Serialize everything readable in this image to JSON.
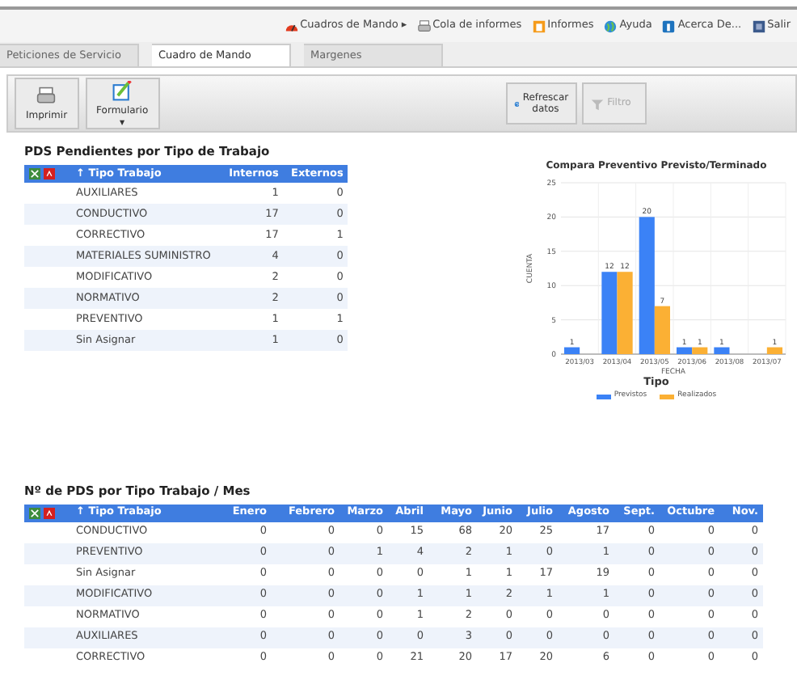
{
  "top_menu": [
    {
      "label": "Cuadros de Mando ▸",
      "kind": "dashboard"
    },
    {
      "label": "Cola de informes",
      "kind": "printer"
    },
    {
      "label": "Informes",
      "kind": "report"
    },
    {
      "label": "Ayuda",
      "kind": "help"
    },
    {
      "label": "Acerca De...",
      "kind": "info"
    },
    {
      "label": "Salir",
      "kind": "exit"
    }
  ],
  "tabs": [
    {
      "label": "Peticiones de Servicio",
      "selected": false
    },
    {
      "label": "Cuadro de Mando",
      "selected": true
    },
    {
      "label": "Margenes",
      "selected": false
    }
  ],
  "toolbar_left": [
    {
      "label": "Imprimir",
      "kind": "printer"
    },
    {
      "label": "Formulario",
      "kind": "form",
      "caret": "▼"
    }
  ],
  "toolbar_right": [
    {
      "label": "Refrescar datos",
      "kind": "refresh",
      "disabled": false
    },
    {
      "label": "Filtro",
      "kind": "filter",
      "disabled": true
    }
  ],
  "pending": {
    "title": "PDS Pendientes por Tipo de Trabajo",
    "columns": [
      "↑ Tipo Trabajo",
      "Internos",
      "Externos"
    ],
    "rows": [
      [
        "AUXILIARES",
        "1",
        "0"
      ],
      [
        "CONDUCTIVO",
        "17",
        "0"
      ],
      [
        "CORRECTIVO",
        "17",
        "1"
      ],
      [
        "MATERIALES SUMINISTRO",
        "4",
        "0"
      ],
      [
        "MODIFICATIVO",
        "2",
        "0"
      ],
      [
        "NORMATIVO",
        "2",
        "0"
      ],
      [
        "PREVENTIVO",
        "1",
        "1"
      ],
      [
        "Sin Asignar",
        "1",
        "0"
      ]
    ]
  },
  "chart": {
    "chart_data": {
      "type": "bar",
      "title": "Compara Preventivo Previsto/Terminado",
      "xlabel": "FECHA",
      "ylabel": "CUENTA",
      "categories": [
        "2013/03",
        "2013/04",
        "2013/05",
        "2013/06",
        "2013/08",
        "2013/07"
      ],
      "series": [
        {
          "name": "Previstos",
          "color": "#3b82f6",
          "values": [
            1,
            12,
            20,
            1,
            1,
            null
          ]
        },
        {
          "name": "Realizados",
          "color": "#fbb034",
          "values": [
            null,
            12,
            7,
            1,
            null,
            1
          ]
        }
      ],
      "ylim": [
        0,
        25
      ],
      "yticks": [
        0,
        5,
        10,
        15,
        20,
        25
      ],
      "data_labels": true,
      "grid": true,
      "legend": {
        "title": "Tipo"
      }
    }
  },
  "monthly": {
    "title": "Nº de PDS por Tipo Trabajo / Mes",
    "columns": [
      "↑ Tipo Trabajo",
      "Enero",
      "Febrero",
      "Marzo",
      "Abril",
      "Mayo",
      "Junio",
      "Julio",
      "Agosto",
      "Sept.",
      "Octubre",
      "Nov."
    ],
    "rows": [
      [
        "CONDUCTIVO",
        "0",
        "0",
        "0",
        "15",
        "68",
        "20",
        "25",
        "17",
        "0",
        "0",
        "0"
      ],
      [
        "PREVENTIVO",
        "0",
        "0",
        "1",
        "4",
        "2",
        "1",
        "0",
        "1",
        "0",
        "0",
        "0"
      ],
      [
        "Sin Asignar",
        "0",
        "0",
        "0",
        "0",
        "1",
        "1",
        "17",
        "19",
        "0",
        "0",
        "0"
      ],
      [
        "MODIFICATIVO",
        "0",
        "0",
        "0",
        "1",
        "1",
        "2",
        "1",
        "1",
        "0",
        "0",
        "0"
      ],
      [
        "NORMATIVO",
        "0",
        "0",
        "0",
        "1",
        "2",
        "0",
        "0",
        "0",
        "0",
        "0",
        "0"
      ],
      [
        "AUXILIARES",
        "0",
        "0",
        "0",
        "0",
        "3",
        "0",
        "0",
        "0",
        "0",
        "0",
        "0"
      ],
      [
        "CORRECTIVO",
        "0",
        "0",
        "0",
        "21",
        "20",
        "17",
        "20",
        "6",
        "0",
        "0",
        "0"
      ]
    ]
  }
}
